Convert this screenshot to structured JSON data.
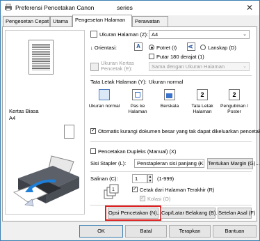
{
  "window": {
    "title": "Preferensi Pencetakan Canon",
    "title_suffix": "series"
  },
  "tabs": [
    {
      "label": "Pengesetan Cepat"
    },
    {
      "label": "Utama"
    },
    {
      "label": "Pengesetan Halaman"
    },
    {
      "label": "Perawatan"
    }
  ],
  "preview": {
    "paper_type": "Kertas Biasa",
    "paper_size": "A4"
  },
  "page_setup": {
    "page_size_label": "Ukuran Halaman (Z):",
    "page_size_value": "A4",
    "orientation_label": "Orientasi:",
    "portrait_label": "Potret (I)",
    "landscape_label": "Lanskap (D)",
    "rotate_label": "Putar 180 derajat (1)",
    "printer_paper_label": "Ukuran Kertas Pencetak (E):",
    "printer_paper_value": "Sama dengan Ukuran Halaman",
    "layout_label": "Tata Letak Halaman (Y):",
    "layout_value": "Ukuran normal",
    "layouts": [
      {
        "label": "Ukuran normal"
      },
      {
        "label": "Pas ke Halaman"
      },
      {
        "label": "Berskala"
      },
      {
        "label": "Tata Letak Halaman"
      },
      {
        "label": "Pengubinan / Poster"
      }
    ],
    "auto_reduce_label": "Otomatis kurangi dokumen besar yang tak dapat dikeluarkan pencetak (H)",
    "duplex_label": "Pencetakan Dupleks (Manual) (X)",
    "stapling_label": "Sisi Stapler (L):",
    "stapling_value": "Penstapleran sisi panjang (Kri)",
    "margin_button": "Tentukan Margin (G)...",
    "copies_label": "Salinan (C):",
    "copies_value": "1",
    "copies_range": "(1-999)",
    "reverse_label": "Cetak dari Halaman Terakhir (R)",
    "collate_label": "Kolasi (O)",
    "print_options_button": "Opsi Pencetakan (N)...",
    "stamp_button": "Cap/Latar Belakang (B)...",
    "defaults_button": "Setelan Asal (F)"
  },
  "footer": {
    "ok": "OK",
    "cancel": "Batal",
    "apply": "Terapkan",
    "help": "Bantuan"
  }
}
